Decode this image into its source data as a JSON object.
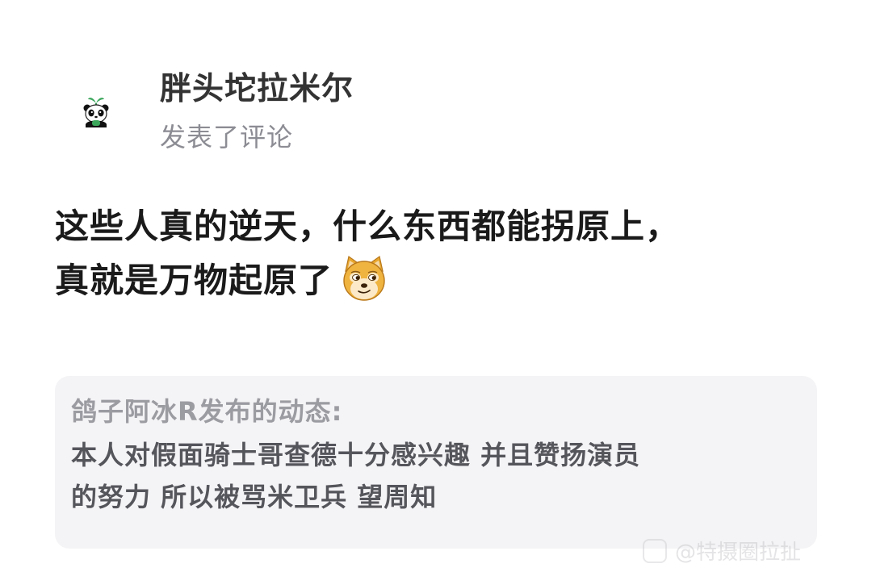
{
  "author": {
    "name": "胖头坨拉米尔",
    "action": "发表了评论"
  },
  "comment": {
    "line1": "这些人真的逆天，什么东西都能拐原上，",
    "line2": "真就是万物起原了",
    "emoji": "doge-emoji"
  },
  "quote": {
    "source": "鸽子阿冰R发布的动态:",
    "body_line1": "本人对假面骑士哥查德十分感兴趣 并且赞扬演员",
    "body_line2": "的努力 所以被骂米卫兵 望周知"
  },
  "watermark": {
    "text": "@特摄圈拉扯"
  },
  "colors": {
    "name": "#333333",
    "meta": "#8c8c94",
    "comment": "#1a1a1a",
    "card_bg": "#f4f4f6",
    "quote_source": "#9b9ba2",
    "quote_body": "#55555c"
  }
}
